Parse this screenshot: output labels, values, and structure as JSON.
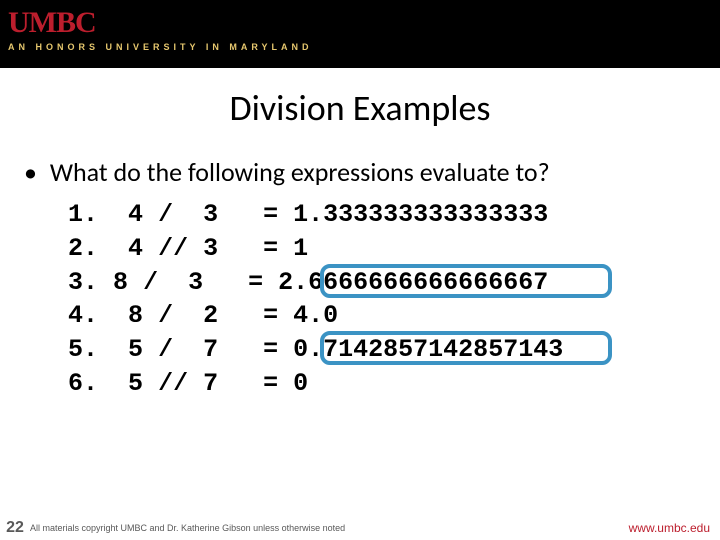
{
  "header": {
    "logo": "UMBC",
    "tagline": "AN HONORS UNIVERSITY IN MARYLAND"
  },
  "title": "Division Examples",
  "prompt": "What do the following expressions evaluate to?",
  "rows": [
    {
      "n": "1.",
      "a": "4",
      "op": "/",
      "b": "3",
      "eq": "=",
      "res": "1.333333333333333"
    },
    {
      "n": "2.",
      "a": "4",
      "op": "//",
      "b": "3",
      "eq": "=",
      "res": "1"
    },
    {
      "n": "3.",
      "a": "8",
      "op": "/",
      "b": "3",
      "eq": "=",
      "res": "2.6666666666666667"
    },
    {
      "n": "4.",
      "a": "8",
      "op": "/",
      "b": "2",
      "eq": "=",
      "res": "4.0"
    },
    {
      "n": "5.",
      "a": "5",
      "op": "/",
      "b": "7",
      "eq": "=",
      "res": "0.7142857142857143"
    },
    {
      "n": "6.",
      "a": "5",
      "op": "//",
      "b": "7",
      "eq": "=",
      "res": "0"
    }
  ],
  "footer": {
    "slide_number": "22",
    "copyright": "All materials copyright UMBC and Dr. Katherine Gibson unless otherwise noted",
    "url": "www.umbc.edu"
  }
}
